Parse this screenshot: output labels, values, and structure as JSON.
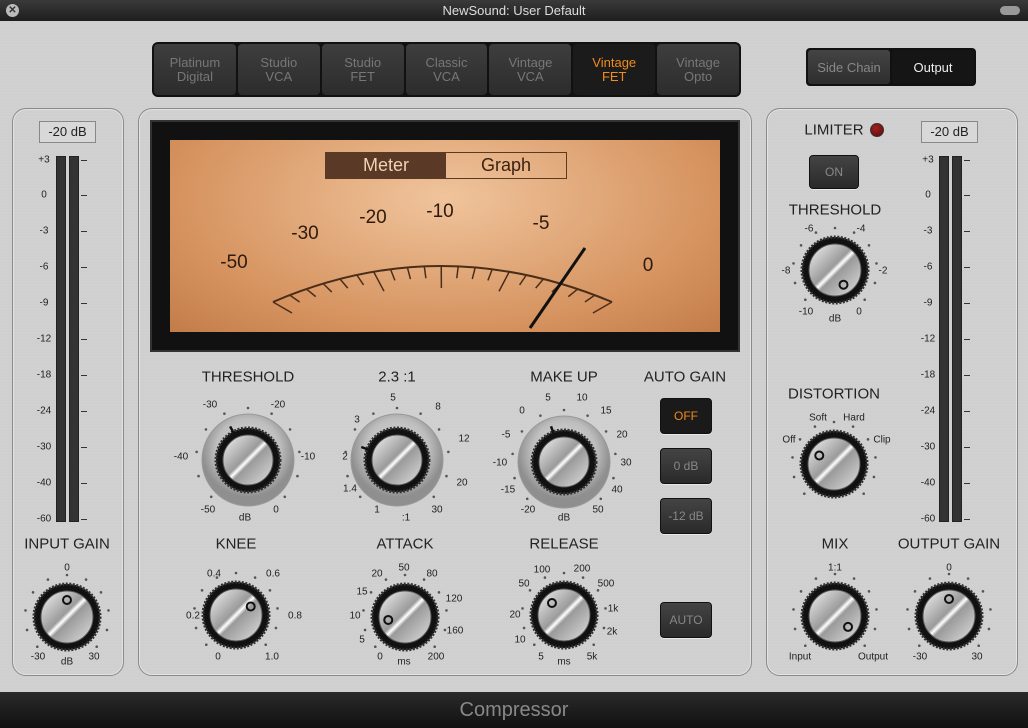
{
  "window": {
    "title": "NewSound: User Default",
    "footer_title": "Compressor"
  },
  "models": [
    {
      "line1": "Platinum",
      "line2": "Digital",
      "active": false
    },
    {
      "line1": "Studio",
      "line2": "VCA",
      "active": false
    },
    {
      "line1": "Studio",
      "line2": "FET",
      "active": false
    },
    {
      "line1": "Classic",
      "line2": "VCA",
      "active": false
    },
    {
      "line1": "Vintage",
      "line2": "VCA",
      "active": false
    },
    {
      "line1": "Vintage",
      "line2": "FET",
      "active": true
    },
    {
      "line1": "Vintage",
      "line2": "Opto",
      "active": false
    }
  ],
  "view_toggle": {
    "side_chain": "Side Chain",
    "output": "Output",
    "selected": "Output"
  },
  "meter": {
    "tab_meter": "Meter",
    "tab_graph": "Graph",
    "selected": "Meter",
    "scale": [
      "-50",
      "-30",
      "-20",
      "-10",
      "-5",
      "0"
    ]
  },
  "input": {
    "readout": "-20 dB",
    "level_db": -20,
    "scale": [
      "+3",
      "0",
      "-3",
      "-6",
      "-9",
      "-12",
      "-18",
      "-24",
      "-30",
      "-40",
      "-60"
    ]
  },
  "output": {
    "readout": "-20 dB",
    "level_db": -20,
    "scale": [
      "+3",
      "0",
      "-3",
      "-6",
      "-9",
      "-12",
      "-18",
      "-24",
      "-30",
      "-40",
      "-60"
    ]
  },
  "limiter": {
    "label": "LIMITER",
    "button": "ON",
    "led_color": "#5a0a0a"
  },
  "auto_gain": {
    "title": "AUTO GAIN",
    "off": "OFF",
    "zero": "0 dB",
    "minus12": "-12 dB",
    "auto": "AUTO",
    "active_color": "#f28a1c"
  },
  "knobs": {
    "threshold": {
      "title": "THRESHOLD",
      "labels": [
        "-30",
        "-20",
        "-40",
        "-10",
        "-50",
        "0",
        "dB"
      ]
    },
    "ratio": {
      "title": "2.3 :1",
      "labels": [
        "5",
        "8",
        "3",
        "12",
        "2",
        "20",
        "1.4",
        "1",
        "30",
        ":1"
      ]
    },
    "makeup": {
      "title": "MAKE UP",
      "labels": [
        "0",
        "5",
        "10",
        "15",
        "-5",
        "20",
        "-10",
        "30",
        "-15",
        "40",
        "-20",
        "50",
        "dB"
      ]
    },
    "knee": {
      "title": "KNEE",
      "labels": [
        "0.4",
        "0.6",
        "0.2",
        "0.8",
        "0",
        "1.0"
      ]
    },
    "attack": {
      "title": "ATTACK",
      "labels": [
        "50",
        "20",
        "80",
        "15",
        "120",
        "10",
        "5",
        "160",
        "0",
        "ms",
        "200"
      ]
    },
    "release": {
      "title": "RELEASE",
      "labels": [
        "100",
        "200",
        "50",
        "500",
        "20",
        "1k",
        "10",
        "2k",
        "5",
        "ms",
        "5k"
      ]
    },
    "input_gain": {
      "title": "INPUT GAIN",
      "labels": [
        "0",
        "-30",
        "30",
        "dB"
      ]
    },
    "limiter_threshold": {
      "title": "THRESHOLD",
      "labels": [
        "-6",
        "-4",
        "-8",
        "-2",
        "-10",
        "0",
        "dB"
      ]
    },
    "distortion": {
      "title": "DISTORTION",
      "labels": [
        "Soft",
        "Hard",
        "Off",
        "Clip"
      ]
    },
    "mix": {
      "title": "MIX",
      "labels": [
        "1:1",
        "Input",
        "Output"
      ]
    },
    "output_gain": {
      "title": "OUTPUT GAIN",
      "labels": [
        "0",
        "-30",
        "30",
        "dB"
      ]
    }
  }
}
